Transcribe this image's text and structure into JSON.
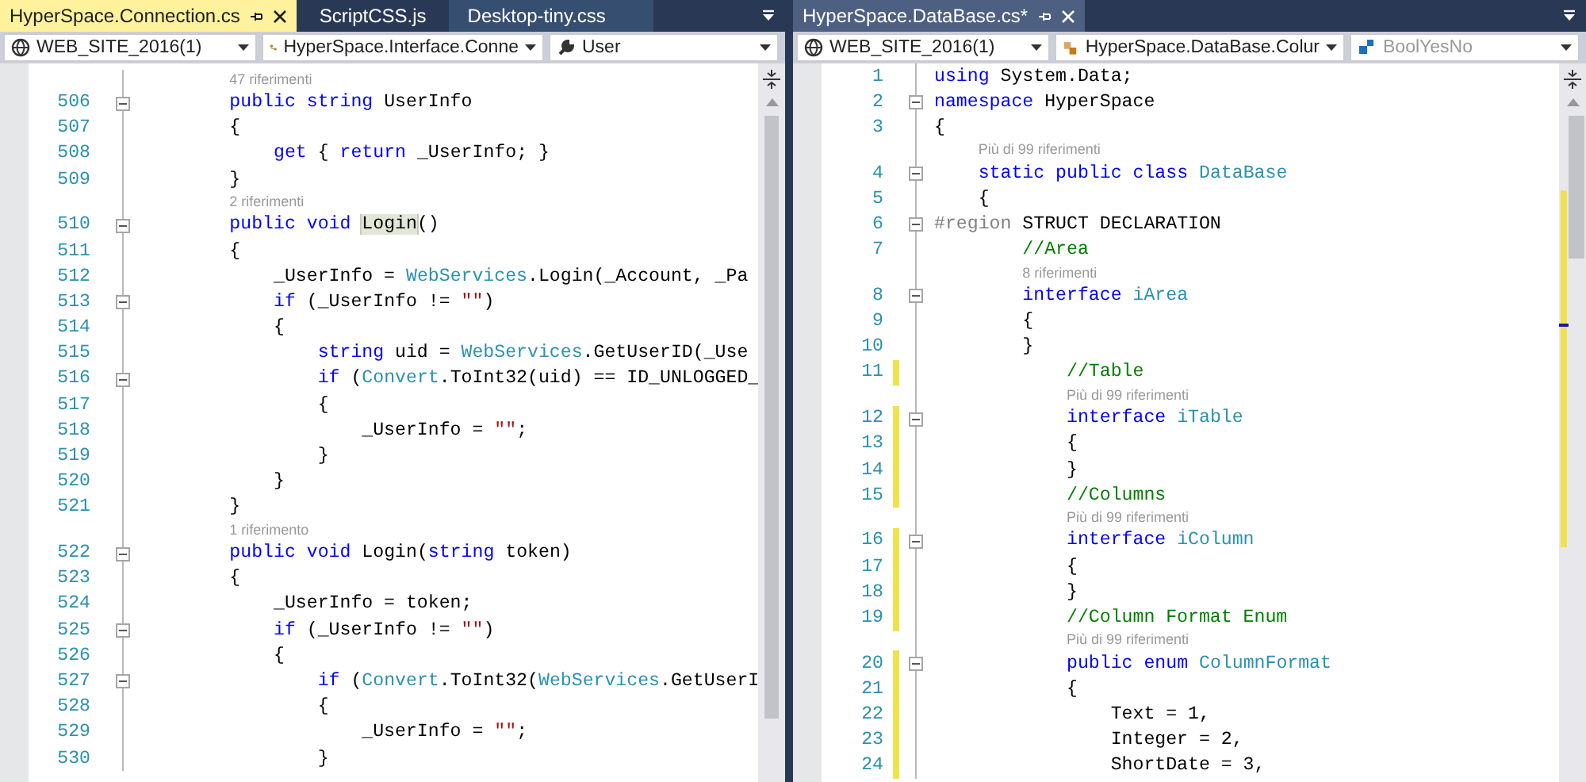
{
  "panes": [
    {
      "active": true,
      "tabs": [
        {
          "label": "HyperSpace.Connection.cs",
          "selected": true,
          "hovered": false
        },
        {
          "label": "ScriptCSS.js",
          "selected": false,
          "hovered": false
        },
        {
          "label": "Desktop-tiny.css",
          "selected": false,
          "hovered": true
        }
      ],
      "navigation": [
        {
          "kind": "project",
          "label": "WEB_SITE_2016(1)",
          "disabled": false
        },
        {
          "kind": "class",
          "label": "HyperSpace.Interface.Conne",
          "disabled": false
        },
        {
          "kind": "property",
          "label": "User",
          "disabled": false
        }
      ],
      "lines": [
        {
          "kind": "lens",
          "text": "47 riferimenti"
        },
        {
          "kind": "code",
          "number": "506",
          "fold": true,
          "changed": false,
          "tokens": [
            {
              "text": "        public",
              "kind": "kw"
            },
            {
              "text": " string",
              "kind": "kw"
            },
            {
              "text": " UserInfo",
              "kind": "plain"
            }
          ]
        },
        {
          "kind": "code",
          "number": "507",
          "fold": false,
          "changed": false,
          "tokens": [
            {
              "text": "        {",
              "kind": "plain"
            }
          ]
        },
        {
          "kind": "code",
          "number": "508",
          "fold": false,
          "changed": false,
          "tokens": [
            {
              "text": "            get",
              "kind": "kw"
            },
            {
              "text": " { ",
              "kind": "plain"
            },
            {
              "text": "return",
              "kind": "kw"
            },
            {
              "text": " _UserInfo; }",
              "kind": "plain"
            }
          ]
        },
        {
          "kind": "code",
          "number": "509",
          "fold": false,
          "changed": false,
          "tokens": [
            {
              "text": "        }",
              "kind": "plain"
            }
          ]
        },
        {
          "kind": "lens",
          "text": "2 riferimenti"
        },
        {
          "kind": "code",
          "number": "510",
          "fold": true,
          "changed": false,
          "tokens": [
            {
              "text": "        public",
              "kind": "kw"
            },
            {
              "text": " void ",
              "kind": "kw"
            },
            {
              "text": "Login",
              "kind": "highlight"
            },
            {
              "text": "()",
              "kind": "plain"
            }
          ]
        },
        {
          "kind": "code",
          "number": "511",
          "fold": false,
          "changed": false,
          "tokens": [
            {
              "text": "        {",
              "kind": "plain"
            }
          ]
        },
        {
          "kind": "code",
          "number": "512",
          "fold": false,
          "changed": false,
          "tokens": [
            {
              "text": "            _UserInfo = ",
              "kind": "plain"
            },
            {
              "text": "WebServices",
              "kind": "type"
            },
            {
              "text": ".Login(_Account, _Pa",
              "kind": "plain"
            }
          ]
        },
        {
          "kind": "code",
          "number": "513",
          "fold": true,
          "changed": false,
          "tokens": [
            {
              "text": "            if",
              "kind": "kw"
            },
            {
              "text": " (_UserInfo != ",
              "kind": "plain"
            },
            {
              "text": "\"\"",
              "kind": "str"
            },
            {
              "text": ")",
              "kind": "plain"
            }
          ]
        },
        {
          "kind": "code",
          "number": "514",
          "fold": false,
          "changed": false,
          "tokens": [
            {
              "text": "            {",
              "kind": "plain"
            }
          ]
        },
        {
          "kind": "code",
          "number": "515",
          "fold": false,
          "changed": false,
          "tokens": [
            {
              "text": "                string",
              "kind": "kw"
            },
            {
              "text": " uid = ",
              "kind": "plain"
            },
            {
              "text": "WebServices",
              "kind": "type"
            },
            {
              "text": ".GetUserID(_Use",
              "kind": "plain"
            }
          ]
        },
        {
          "kind": "code",
          "number": "516",
          "fold": true,
          "changed": false,
          "tokens": [
            {
              "text": "                if",
              "kind": "kw"
            },
            {
              "text": " (",
              "kind": "plain"
            },
            {
              "text": "Convert",
              "kind": "type"
            },
            {
              "text": ".ToInt32(uid) == ID_UNLOGGED_",
              "kind": "plain"
            }
          ]
        },
        {
          "kind": "code",
          "number": "517",
          "fold": false,
          "changed": false,
          "tokens": [
            {
              "text": "                {",
              "kind": "plain"
            }
          ]
        },
        {
          "kind": "code",
          "number": "518",
          "fold": false,
          "changed": false,
          "tokens": [
            {
              "text": "                    _UserInfo = ",
              "kind": "plain"
            },
            {
              "text": "\"\"",
              "kind": "str"
            },
            {
              "text": ";",
              "kind": "plain"
            }
          ]
        },
        {
          "kind": "code",
          "number": "519",
          "fold": false,
          "changed": false,
          "tokens": [
            {
              "text": "                }",
              "kind": "plain"
            }
          ]
        },
        {
          "kind": "code",
          "number": "520",
          "fold": false,
          "changed": false,
          "tokens": [
            {
              "text": "            }",
              "kind": "plain"
            }
          ]
        },
        {
          "kind": "code",
          "number": "521",
          "fold": false,
          "changed": false,
          "tokens": [
            {
              "text": "        }",
              "kind": "plain"
            }
          ]
        },
        {
          "kind": "lens",
          "text": "1 riferimento"
        },
        {
          "kind": "code",
          "number": "522",
          "fold": true,
          "changed": false,
          "tokens": [
            {
              "text": "        public",
              "kind": "kw"
            },
            {
              "text": " void",
              "kind": "kw"
            },
            {
              "text": " Login(",
              "kind": "plain"
            },
            {
              "text": "string",
              "kind": "kw"
            },
            {
              "text": " token)",
              "kind": "plain"
            }
          ]
        },
        {
          "kind": "code",
          "number": "523",
          "fold": false,
          "changed": false,
          "tokens": [
            {
              "text": "        {",
              "kind": "plain"
            }
          ]
        },
        {
          "kind": "code",
          "number": "524",
          "fold": false,
          "changed": false,
          "tokens": [
            {
              "text": "            _UserInfo = token;",
              "kind": "plain"
            }
          ]
        },
        {
          "kind": "code",
          "number": "525",
          "fold": true,
          "changed": false,
          "tokens": [
            {
              "text": "            if",
              "kind": "kw"
            },
            {
              "text": " (_UserInfo != ",
              "kind": "plain"
            },
            {
              "text": "\"\"",
              "kind": "str"
            },
            {
              "text": ")",
              "kind": "plain"
            }
          ]
        },
        {
          "kind": "code",
          "number": "526",
          "fold": false,
          "changed": false,
          "tokens": [
            {
              "text": "            {",
              "kind": "plain"
            }
          ]
        },
        {
          "kind": "code",
          "number": "527",
          "fold": true,
          "changed": false,
          "tokens": [
            {
              "text": "                if",
              "kind": "kw"
            },
            {
              "text": " (",
              "kind": "plain"
            },
            {
              "text": "Convert",
              "kind": "type"
            },
            {
              "text": ".ToInt32(",
              "kind": "plain"
            },
            {
              "text": "WebServices",
              "kind": "type"
            },
            {
              "text": ".GetUserI",
              "kind": "plain"
            }
          ]
        },
        {
          "kind": "code",
          "number": "528",
          "fold": false,
          "changed": false,
          "tokens": [
            {
              "text": "                {",
              "kind": "plain"
            }
          ]
        },
        {
          "kind": "code",
          "number": "529",
          "fold": false,
          "changed": false,
          "tokens": [
            {
              "text": "                    _UserInfo = ",
              "kind": "plain"
            },
            {
              "text": "\"\"",
              "kind": "str"
            },
            {
              "text": ";",
              "kind": "plain"
            }
          ]
        },
        {
          "kind": "code",
          "number": "530",
          "fold": false,
          "changed": false,
          "tokens": [
            {
              "text": "                }",
              "kind": "plain"
            }
          ]
        }
      ]
    },
    {
      "active": false,
      "tabs": [
        {
          "label": "HyperSpace.DataBase.cs*",
          "selected": true,
          "hovered": false
        }
      ],
      "navigation": [
        {
          "kind": "project",
          "label": "WEB_SITE_2016(1)",
          "disabled": false
        },
        {
          "kind": "enum",
          "label": "HyperSpace.DataBase.Colur",
          "disabled": false
        },
        {
          "kind": "enum-member",
          "label": "BoolYesNo",
          "disabled": true
        }
      ],
      "lines": [
        {
          "kind": "code",
          "number": "1",
          "fold": false,
          "changed": false,
          "tokens": [
            {
              "text": "using",
              "kind": "kw"
            },
            {
              "text": " System.Data;",
              "kind": "plain"
            }
          ]
        },
        {
          "kind": "code",
          "number": "2",
          "fold": true,
          "changed": false,
          "tokens": [
            {
              "text": "namespace",
              "kind": "kw"
            },
            {
              "text": " HyperSpace",
              "kind": "plain"
            }
          ]
        },
        {
          "kind": "code",
          "number": "3",
          "fold": false,
          "changed": false,
          "tokens": [
            {
              "text": "{",
              "kind": "plain"
            }
          ]
        },
        {
          "kind": "lens",
          "text": "Più di 99 riferimenti"
        },
        {
          "kind": "code",
          "number": "4",
          "fold": true,
          "changed": false,
          "tokens": [
            {
              "text": "    static",
              "kind": "kw"
            },
            {
              "text": " public",
              "kind": "kw"
            },
            {
              "text": " class",
              "kind": "kw"
            },
            {
              "text": " DataBase",
              "kind": "type"
            }
          ]
        },
        {
          "kind": "code",
          "number": "5",
          "fold": false,
          "changed": false,
          "tokens": [
            {
              "text": "    {",
              "kind": "plain"
            }
          ]
        },
        {
          "kind": "code",
          "number": "6",
          "fold": true,
          "changed": false,
          "tokens": [
            {
              "text": "#region",
              "kind": "region"
            },
            {
              "text": " STRUCT DECLARATION",
              "kind": "plain"
            }
          ]
        },
        {
          "kind": "code",
          "number": "7",
          "fold": false,
          "changed": false,
          "tokens": [
            {
              "text": "        //Area",
              "kind": "comment"
            }
          ]
        },
        {
          "kind": "lens",
          "text": "8 riferimenti"
        },
        {
          "kind": "code",
          "number": "8",
          "fold": true,
          "changed": false,
          "tokens": [
            {
              "text": "        interface",
              "kind": "kw"
            },
            {
              "text": " iArea",
              "kind": "type"
            }
          ]
        },
        {
          "kind": "code",
          "number": "9",
          "fold": false,
          "changed": false,
          "tokens": [
            {
              "text": "        {",
              "kind": "plain"
            }
          ]
        },
        {
          "kind": "code",
          "number": "10",
          "fold": false,
          "changed": false,
          "tokens": [
            {
              "text": "        }",
              "kind": "plain"
            }
          ]
        },
        {
          "kind": "code",
          "number": "11",
          "fold": false,
          "changed": true,
          "tokens": [
            {
              "text": "            //Table",
              "kind": "comment"
            }
          ]
        },
        {
          "kind": "lens",
          "text": "Più di 99 riferimenti"
        },
        {
          "kind": "code",
          "number": "12",
          "fold": true,
          "changed": true,
          "tokens": [
            {
              "text": "            interface",
              "kind": "kw"
            },
            {
              "text": " iTable",
              "kind": "type"
            }
          ]
        },
        {
          "kind": "code",
          "number": "13",
          "fold": false,
          "changed": true,
          "tokens": [
            {
              "text": "            {",
              "kind": "plain"
            }
          ]
        },
        {
          "kind": "code",
          "number": "14",
          "fold": false,
          "changed": true,
          "tokens": [
            {
              "text": "            }",
              "kind": "plain"
            }
          ]
        },
        {
          "kind": "code",
          "number": "15",
          "fold": false,
          "changed": true,
          "tokens": [
            {
              "text": "            //Columns",
              "kind": "comment"
            }
          ]
        },
        {
          "kind": "lens",
          "text": "Più di 99 riferimenti"
        },
        {
          "kind": "code",
          "number": "16",
          "fold": true,
          "changed": true,
          "tokens": [
            {
              "text": "            interface",
              "kind": "kw"
            },
            {
              "text": " iColumn",
              "kind": "type"
            }
          ]
        },
        {
          "kind": "code",
          "number": "17",
          "fold": false,
          "changed": true,
          "tokens": [
            {
              "text": "            {",
              "kind": "plain"
            }
          ]
        },
        {
          "kind": "code",
          "number": "18",
          "fold": false,
          "changed": true,
          "tokens": [
            {
              "text": "            }",
              "kind": "plain"
            }
          ]
        },
        {
          "kind": "code",
          "number": "19",
          "fold": false,
          "changed": true,
          "tokens": [
            {
              "text": "            //Column Format Enum",
              "kind": "comment"
            }
          ]
        },
        {
          "kind": "lens",
          "text": "Più di 99 riferimenti"
        },
        {
          "kind": "code",
          "number": "20",
          "fold": true,
          "changed": true,
          "tokens": [
            {
              "text": "            public",
              "kind": "kw"
            },
            {
              "text": " enum",
              "kind": "kw"
            },
            {
              "text": " ColumnFormat",
              "kind": "type"
            }
          ]
        },
        {
          "kind": "code",
          "number": "21",
          "fold": false,
          "changed": true,
          "tokens": [
            {
              "text": "            {",
              "kind": "plain"
            }
          ]
        },
        {
          "kind": "code",
          "number": "22",
          "fold": false,
          "changed": true,
          "tokens": [
            {
              "text": "                Text = 1,",
              "kind": "plain"
            }
          ]
        },
        {
          "kind": "code",
          "number": "23",
          "fold": false,
          "changed": true,
          "tokens": [
            {
              "text": "                Integer = 2,",
              "kind": "plain"
            }
          ]
        },
        {
          "kind": "code",
          "number": "24",
          "fold": false,
          "changed": true,
          "tokens": [
            {
              "text": "                ShortDate = 3,",
              "kind": "plain"
            }
          ]
        }
      ]
    }
  ]
}
